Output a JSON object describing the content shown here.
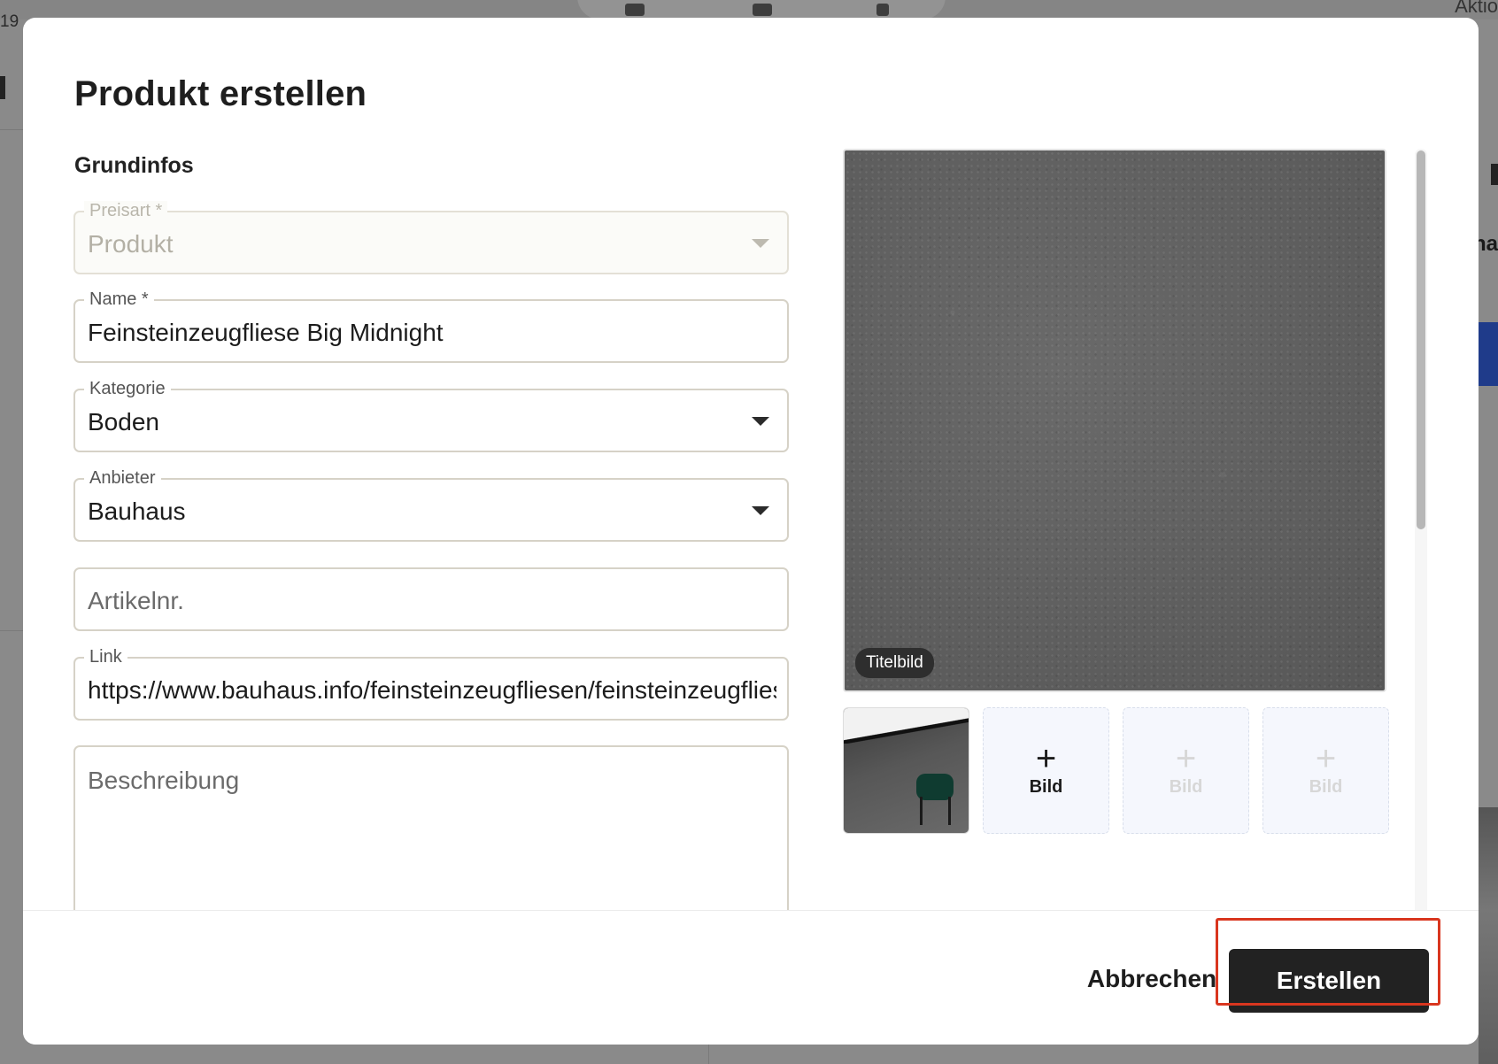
{
  "background": {
    "left_text": "19",
    "right_text": "Aktio",
    "right_fragment": "ha"
  },
  "modal": {
    "title": "Produkt erstellen",
    "section_title": "Grundinfos",
    "fields": {
      "price_type": {
        "label": "Preisart *",
        "value": "Produkt"
      },
      "name": {
        "label": "Name *",
        "value": "Feinsteinzeugfliese Big Midnight"
      },
      "category": {
        "label": "Kategorie",
        "value": "Boden"
      },
      "vendor": {
        "label": "Anbieter",
        "value": "Bauhaus"
      },
      "article_number": {
        "placeholder": "Artikelnr."
      },
      "link": {
        "label": "Link",
        "value": "https://www.bauhaus.info/feinsteinzeugfliesen/feinsteinzeugfliese-big-midnight"
      },
      "description": {
        "placeholder": "Beschreibung"
      }
    },
    "images": {
      "title_badge": "Titelbild",
      "add_slots": [
        {
          "plus": "+",
          "label": "Bild"
        },
        {
          "plus": "+",
          "label": "Bild"
        },
        {
          "plus": "+",
          "label": "Bild"
        }
      ]
    },
    "footer": {
      "cancel_label": "Abbrechen",
      "create_label": "Erstellen"
    }
  },
  "colors": {
    "primary_button": "#222222",
    "highlight_border": "#d9361f",
    "field_border": "#d6d2c7",
    "add_slot_bg": "#f5f7fd"
  }
}
